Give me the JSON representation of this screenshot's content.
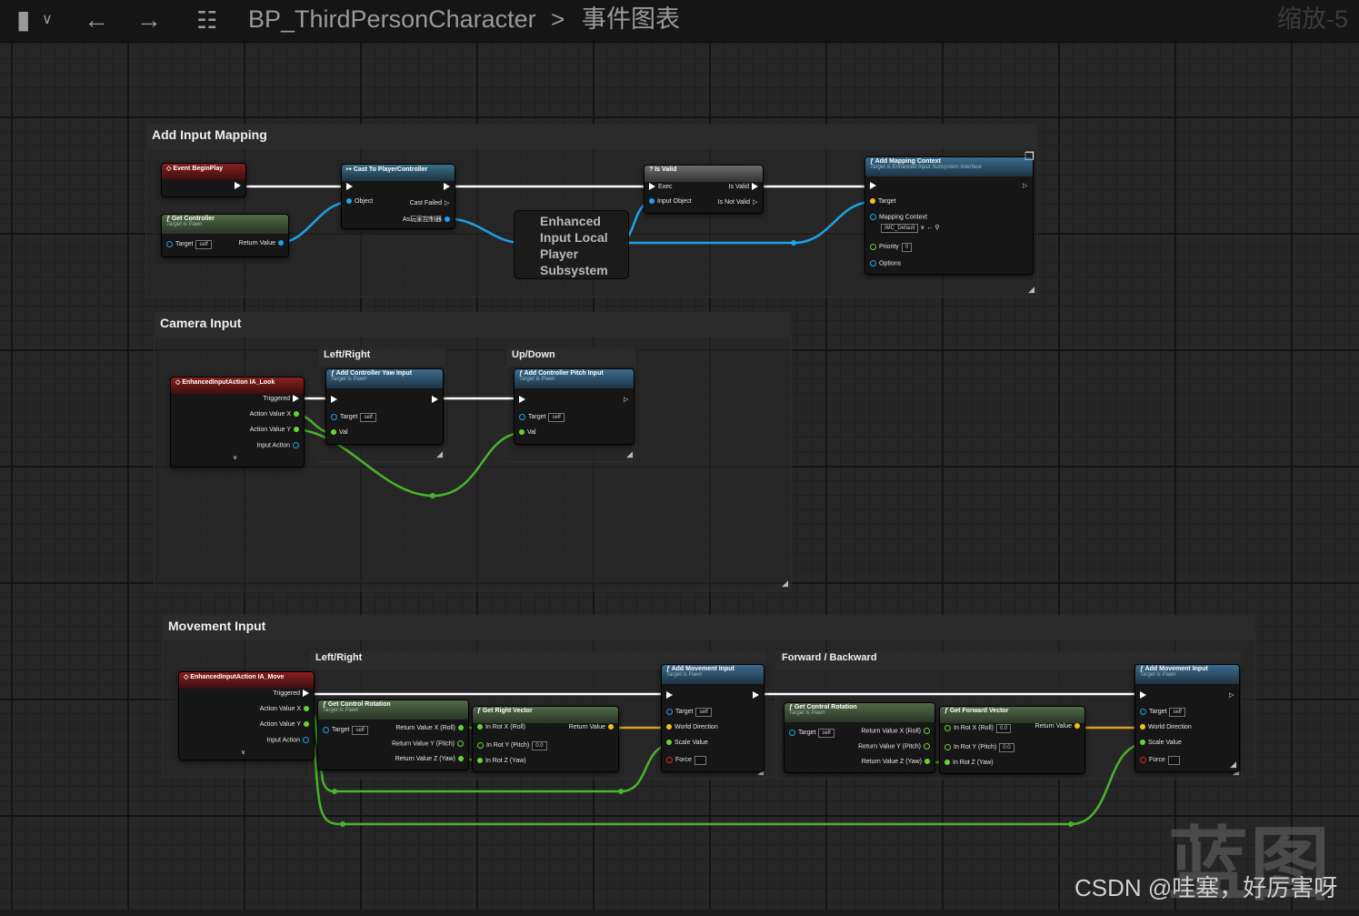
{
  "toolbar": {
    "bookmark_icon": "bookmark-icon",
    "back_icon": "arrow-left-icon",
    "forward_icon": "arrow-right-icon",
    "graph_icon": "blueprint-graph-icon",
    "breadcrumb_blueprint": "BP_ThirdPersonCharacter",
    "breadcrumb_separator": ">",
    "breadcrumb_graph": "事件图表",
    "zoom_label": "缩放-5"
  },
  "comments": {
    "add_input_mapping": "Add Input Mapping",
    "camera_input": "Camera Input",
    "camera_left_right": "Left/Right",
    "camera_up_down": "Up/Down",
    "movement_input": "Movement Input",
    "movement_left_right": "Left/Right",
    "movement_forward_backward": "Forward / Backward"
  },
  "nodes": {
    "event_begin_play": {
      "title": "Event BeginPlay"
    },
    "get_controller": {
      "title": "Get Controller",
      "subtitle": "Target is Pawn",
      "target": "Target",
      "target_value": "self",
      "return": "Return Value"
    },
    "cast_player_controller": {
      "title": "Cast To PlayerController",
      "object": "Object",
      "cast_failed": "Cast Failed",
      "as_pc": "As玩家控制器"
    },
    "subsystem": {
      "title": "Enhanced Input Local Player Subsystem"
    },
    "is_valid": {
      "title": "Is Valid",
      "exec": "Exec",
      "input_object": "Input Object",
      "is_valid": "Is Valid",
      "is_not_valid": "Is Not Valid"
    },
    "add_mapping_context": {
      "title": "Add Mapping Context",
      "subtitle": "Target is Enhanced Input Subsystem Interface",
      "target": "Target",
      "mapping_context": "Mapping Context",
      "mapping_value": "IMC_Default",
      "priority": "Priority",
      "priority_value": "0",
      "options": "Options"
    },
    "ia_look": {
      "title": "EnhancedInputAction IA_Look",
      "triggered": "Triggered",
      "action_x": "Action Value X",
      "action_y": "Action Value Y",
      "input_action": "Input Action"
    },
    "add_yaw": {
      "title": "Add Controller Yaw Input",
      "subtitle": "Target is Pawn",
      "target": "Target",
      "target_value": "self",
      "val": "Val"
    },
    "add_pitch": {
      "title": "Add Controller Pitch Input",
      "subtitle": "Target is Pawn",
      "target": "Target",
      "target_value": "self",
      "val": "Val"
    },
    "ia_move": {
      "title": "EnhancedInputAction IA_Move",
      "triggered": "Triggered",
      "action_x": "Action Value X",
      "action_y": "Action Value Y",
      "input_action": "Input Action"
    },
    "get_control_rotation_1": {
      "title": "Get Control Rotation",
      "subtitle": "Target is Pawn",
      "target": "Target",
      "target_value": "self",
      "rx": "Return Value X (Roll)",
      "ry": "Return Value Y (Pitch)",
      "rz": "Return Value Z (Yaw)"
    },
    "get_right_vector": {
      "title": "Get Right Vector",
      "in_x": "In Rot X (Roll)",
      "in_y": "In Rot Y (Pitch)",
      "in_y_value": "0.0",
      "in_z": "In Rot Z (Yaw)",
      "return": "Return Value"
    },
    "add_movement_1": {
      "title": "Add Movement Input",
      "subtitle": "Target is Pawn",
      "target": "Target",
      "target_value": "self",
      "world_direction": "World Direction",
      "scale_value": "Scale Value",
      "force": "Force"
    },
    "get_control_rotation_2": {
      "title": "Get Control Rotation",
      "subtitle": "Target is Pawn",
      "target": "Target",
      "target_value": "self",
      "rx": "Return Value X (Roll)",
      "ry": "Return Value Y (Pitch)",
      "rz": "Return Value Z (Yaw)"
    },
    "get_forward_vector": {
      "title": "Get Forward Vector",
      "in_x": "In Rot X (Roll)",
      "in_x_value": "0.0",
      "in_y": "In Rot Y (Pitch)",
      "in_y_value": "0.0",
      "in_z": "In Rot Z (Yaw)",
      "return": "Return Value"
    },
    "add_movement_2": {
      "title": "Add Movement Input",
      "subtitle": "Target is Pawn",
      "target": "Target",
      "target_value": "self",
      "world_direction": "World Direction",
      "scale_value": "Scale Value",
      "force": "Force"
    }
  },
  "watermark": {
    "logo_text": "蓝图",
    "author": "CSDN @哇塞，好厉害呀"
  },
  "colors": {
    "exec": "#ffffff",
    "object_pin": "#1ea2e8",
    "float_pin": "#68d335",
    "vector_pin": "#f0c020",
    "bool_pin": "#e02020"
  }
}
